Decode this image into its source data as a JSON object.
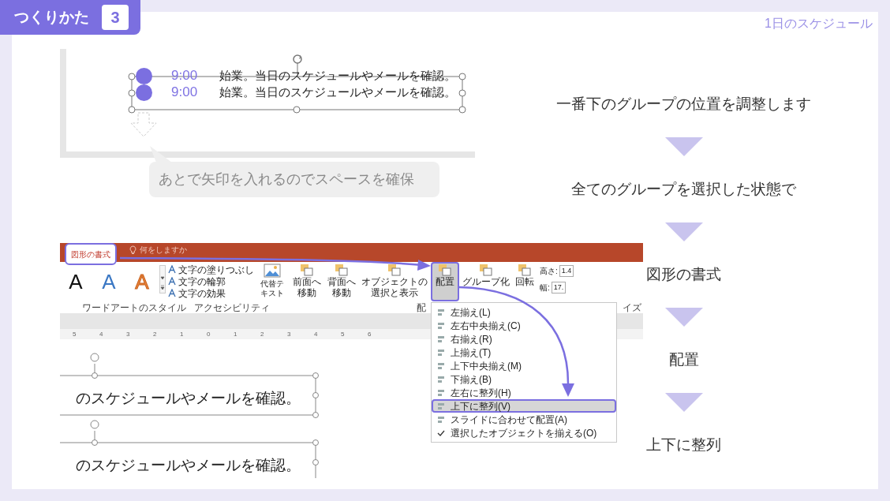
{
  "badge": {
    "label": "つくりかた",
    "number": "3"
  },
  "page_title": "1日のスケジュール",
  "top_shot": {
    "rows": [
      {
        "time": "9:00",
        "text": "始業。当日のスケジュールやメールを確認。"
      },
      {
        "time": "9:00",
        "text": "始業。当日のスケジュールやメールを確認。"
      }
    ]
  },
  "callout": "あとで矢印を入れるのでスペースを確保",
  "ribbon": {
    "tabs": [
      {
        "label": "図形の書式",
        "selected": true
      },
      {
        "label": "何をしますか",
        "selected": false
      }
    ],
    "wordart": [
      {
        "letter": "A",
        "kind": "fill",
        "color": "#111111"
      },
      {
        "letter": "A",
        "kind": "fill",
        "color": "#3b78c4"
      },
      {
        "letter": "A",
        "kind": "outline",
        "color": "#e8843c"
      }
    ],
    "text_options": [
      "文字の塗りつぶし",
      "文字の輪郭",
      "文字の効果"
    ],
    "alt_text": "代替テキスト",
    "arrange": [
      {
        "label": "前面へ移動",
        "pressed": false
      },
      {
        "label": "背面へ移動",
        "pressed": false
      },
      {
        "label": "オブジェクトの選択と表示",
        "pressed": false
      },
      {
        "label": "配置",
        "pressed": true
      },
      {
        "label": "グループ化",
        "pressed": false
      },
      {
        "label": "回転",
        "pressed": false
      }
    ],
    "size": [
      {
        "label": "高さ:",
        "value": "1.4"
      },
      {
        "label": "幅:",
        "value": "17."
      }
    ],
    "group_labels": [
      "ワードアートのスタイル",
      "アクセシビリティ",
      "配",
      "イズ"
    ]
  },
  "menu": [
    {
      "label": "左揃え(L)",
      "selected": false,
      "checked": false
    },
    {
      "label": "左右中央揃え(C)",
      "selected": false,
      "checked": false
    },
    {
      "label": "右揃え(R)",
      "selected": false,
      "checked": false
    },
    {
      "label": "上揃え(T)",
      "selected": false,
      "checked": false
    },
    {
      "label": "上下中央揃え(M)",
      "selected": false,
      "checked": false
    },
    {
      "label": "下揃え(B)",
      "selected": false,
      "checked": false
    },
    {
      "label": "左右に整列(H)",
      "selected": false,
      "checked": false
    },
    {
      "label": "上下に整列(V)",
      "selected": true,
      "checked": false
    },
    {
      "label": "スライドに合わせて配置(A)",
      "selected": false,
      "checked": false
    },
    {
      "label": "選択したオブジェクトを揃える(O)",
      "selected": false,
      "checked": true
    }
  ],
  "ruler": [
    "5",
    "4",
    "3",
    "2",
    "1",
    "0",
    "1",
    "2",
    "3",
    "4",
    "5",
    "6"
  ],
  "bottom_shot": {
    "lines": [
      "のスケジュールやメールを確認。",
      "のスケジュールやメールを確認。"
    ]
  },
  "steps": [
    "一番下のグループの位置を調整します",
    "全てのグループを選択した状態で",
    "図形の書式",
    "配置",
    "上下に整列"
  ]
}
